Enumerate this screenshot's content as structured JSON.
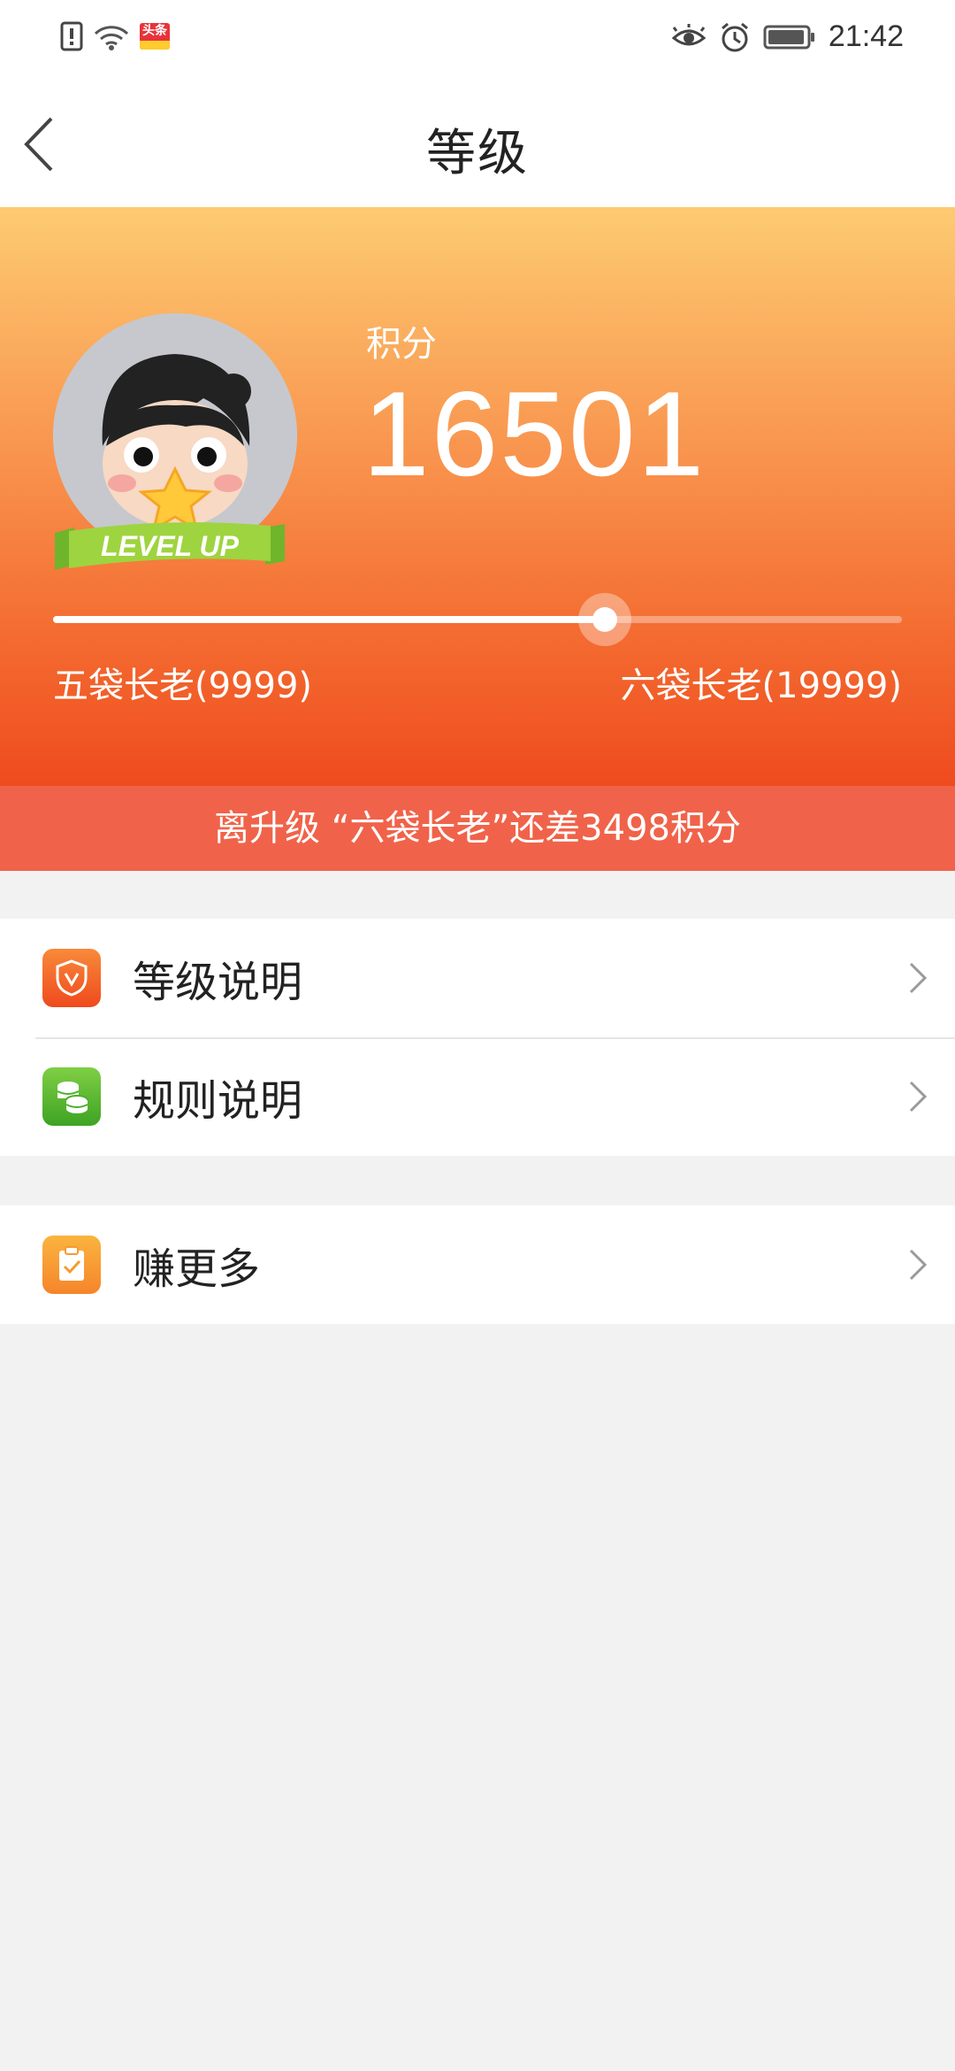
{
  "status_bar": {
    "time": "21:42",
    "icons": [
      "alert-icon",
      "wifi-icon",
      "toutiao-app-icon",
      "eye-icon",
      "alarm-icon",
      "battery-icon"
    ],
    "toutiao_badge": "头条"
  },
  "header": {
    "title": "等级"
  },
  "hero": {
    "points_label": "积分",
    "points_value": "16501",
    "avatar_badge_text": "LEVEL UP",
    "progress": {
      "fraction": 0.6501,
      "current_level_label": "五袋长老(9999)",
      "next_level_label": "六袋长老(19999)"
    }
  },
  "upgrade_message": "离升级 “六袋长老”还差3498积分",
  "menu_groups": [
    {
      "items": [
        {
          "label": "等级说明",
          "icon": "shield-v-icon",
          "color": "#f45b2a"
        },
        {
          "label": "规则说明",
          "icon": "coins-icon",
          "color": "#5cb836"
        }
      ]
    },
    {
      "items": [
        {
          "label": "赚更多",
          "icon": "clipboard-check-icon",
          "color": "#f8982c"
        }
      ]
    }
  ],
  "colors": {
    "hero_top": "#fdcb71",
    "hero_bottom": "#ef4b1e",
    "upgrade_bar": "#f0634a",
    "background": "#f2f2f2"
  }
}
